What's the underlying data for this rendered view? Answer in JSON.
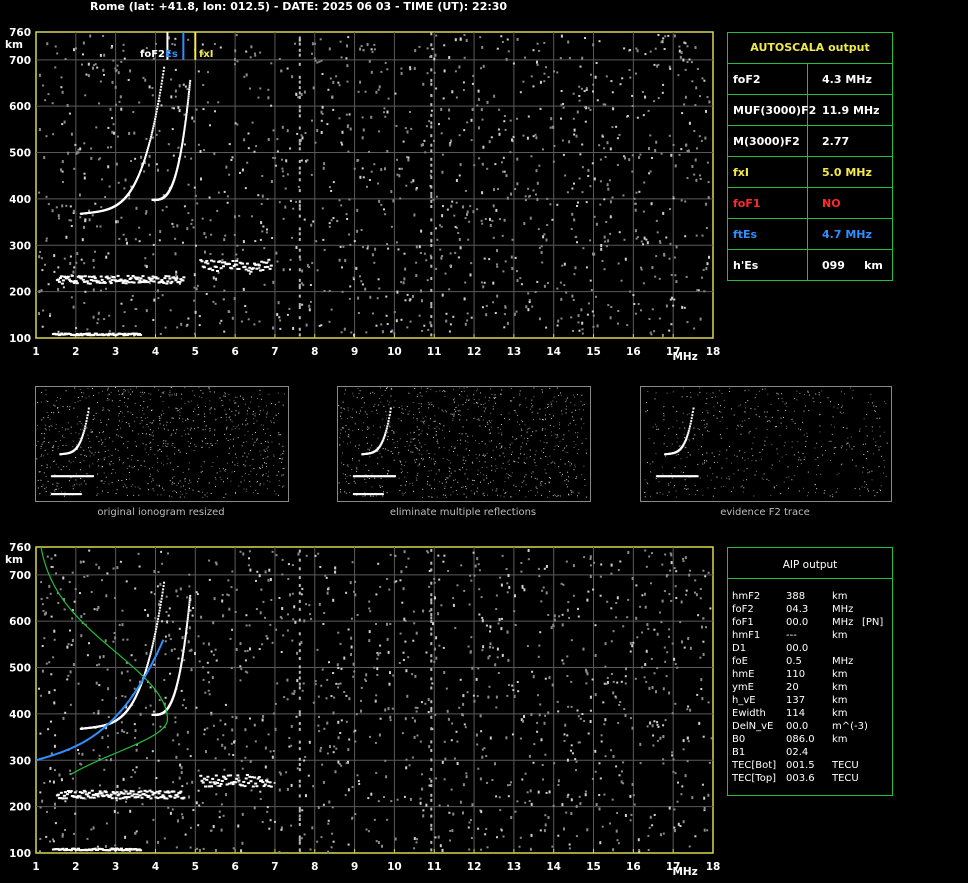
{
  "header": {
    "text": "Rome (lat: +41.8, lon: 012.5) - DATE: 2025 06 03 - TIME (UT): 22:30"
  },
  "ionogram": {
    "y_unit": "km",
    "x_unit": "MHz",
    "y_ticks": [
      "760",
      "700",
      "600",
      "500",
      "400",
      "300",
      "200",
      "100"
    ],
    "x_ticks": [
      "1",
      "2",
      "3",
      "4",
      "5",
      "6",
      "7",
      "8",
      "9",
      "10",
      "11",
      "12",
      "13",
      "14",
      "15",
      "16",
      "17",
      "18"
    ],
    "markers": {
      "foF2_es_label": "foF2",
      "es_label": "Es",
      "fxl_label": "fxI"
    }
  },
  "autoscala": {
    "title": "AUTOSCALA output",
    "rows": [
      {
        "name": "foF2",
        "value": "4.3 MHz",
        "color": "#ffffff"
      },
      {
        "name": "MUF(3000)F2",
        "value": "11.9 MHz",
        "color": "#ffffff"
      },
      {
        "name": "M(3000)F2",
        "value": "2.77",
        "color": "#ffffff"
      },
      {
        "name": "fxI",
        "value": "5.0 MHz",
        "color": "#f2e94a"
      },
      {
        "name": "foF1",
        "value": "NO",
        "color": "#ff2a2a"
      },
      {
        "name": "ftEs",
        "value": "4.7 MHz",
        "color": "#2f8fff"
      },
      {
        "name": "h'Es",
        "value": "099     km",
        "color": "#ffffff"
      }
    ]
  },
  "thumbnails": [
    {
      "caption": "original ionogram resized"
    },
    {
      "caption": "eliminate multiple reflections"
    },
    {
      "caption": "evidence F2 trace"
    }
  ],
  "aip": {
    "title": "AIP output",
    "rows": [
      [
        "hmF2",
        "388",
        "km",
        ""
      ],
      [
        "foF2",
        "04.3",
        "MHz",
        ""
      ],
      [
        "foF1",
        "00.0",
        "MHz",
        "[PN]"
      ],
      [
        "hmF1",
        "---",
        "km",
        ""
      ],
      [
        "D1",
        "00.0",
        "",
        ""
      ],
      [
        "foE",
        "0.5",
        "MHz",
        ""
      ],
      [
        "hmE",
        "110",
        "km",
        ""
      ],
      [
        "ymE",
        "20",
        "km",
        ""
      ],
      [
        "h_vE",
        "137",
        "km",
        ""
      ],
      [
        "Ewidth",
        "114",
        "km",
        ""
      ],
      [
        "DelN_vE",
        "00.0",
        "m^(-3)",
        ""
      ],
      [
        "B0",
        "086.0",
        "km",
        ""
      ],
      [
        "B1",
        "02.4",
        "",
        ""
      ],
      [
        "TEC[Bot]",
        "001.5",
        "TECU",
        ""
      ],
      [
        "TEC[Top]",
        "003.6",
        "TECU",
        ""
      ]
    ]
  },
  "colors": {
    "frame": "#d8d84a",
    "grid": "#5a5a5a",
    "green": "#1fbf3a",
    "yellow": "#f2e94a",
    "blue": "#2f8fff",
    "red": "#ff2a2a"
  }
}
